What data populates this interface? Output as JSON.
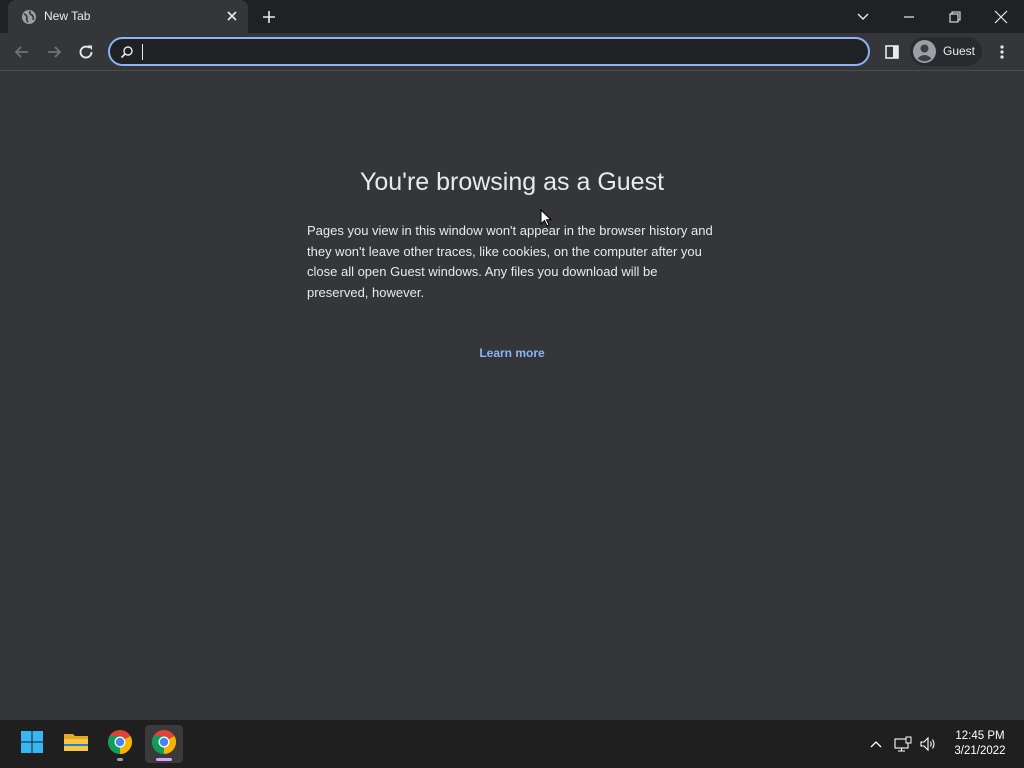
{
  "browser": {
    "tab": {
      "title": "New Tab"
    },
    "omnibox": {
      "value": "",
      "placeholder": ""
    },
    "profile": {
      "label": "Guest"
    }
  },
  "page": {
    "heading": "You're browsing as a Guest",
    "body": "Pages you view in this window won't appear in the browser history and they won't leave other traces, like cookies, on the computer after you close all open Guest windows. Any files you download will be preserved, however.",
    "learn_more": "Learn more"
  },
  "taskbar": {
    "time": "12:45 PM",
    "date": "3/21/2022"
  },
  "colors": {
    "accent": "#8ab4f8",
    "page_bg": "#35363a",
    "frame_bg": "#202124",
    "taskbar_bg": "#1f1f1f"
  },
  "icons": [
    "globe-icon",
    "close-icon",
    "plus-icon",
    "chevron-down-icon",
    "minimize-icon",
    "restore-icon",
    "back-arrow-icon",
    "forward-arrow-icon",
    "reload-icon",
    "search-icon",
    "side-panel-icon",
    "guest-avatar-icon",
    "kebab-menu-icon",
    "windows-start-icon",
    "file-explorer-icon",
    "chrome-icon",
    "chevron-up-icon",
    "network-icon",
    "volume-icon",
    "mouse-cursor-icon"
  ]
}
